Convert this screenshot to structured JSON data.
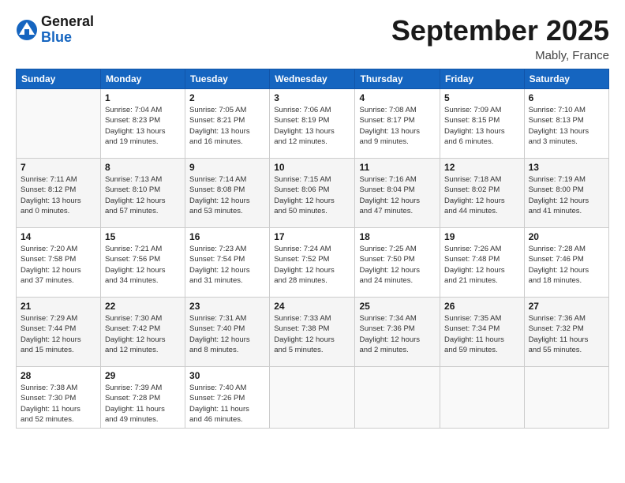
{
  "header": {
    "logo": {
      "general": "General",
      "blue": "Blue"
    },
    "title": "September 2025",
    "location": "Mably, France"
  },
  "weekdays": [
    "Sunday",
    "Monday",
    "Tuesday",
    "Wednesday",
    "Thursday",
    "Friday",
    "Saturday"
  ],
  "weeks": [
    [
      {
        "day": "",
        "info": ""
      },
      {
        "day": "1",
        "info": "Sunrise: 7:04 AM\nSunset: 8:23 PM\nDaylight: 13 hours\nand 19 minutes."
      },
      {
        "day": "2",
        "info": "Sunrise: 7:05 AM\nSunset: 8:21 PM\nDaylight: 13 hours\nand 16 minutes."
      },
      {
        "day": "3",
        "info": "Sunrise: 7:06 AM\nSunset: 8:19 PM\nDaylight: 13 hours\nand 12 minutes."
      },
      {
        "day": "4",
        "info": "Sunrise: 7:08 AM\nSunset: 8:17 PM\nDaylight: 13 hours\nand 9 minutes."
      },
      {
        "day": "5",
        "info": "Sunrise: 7:09 AM\nSunset: 8:15 PM\nDaylight: 13 hours\nand 6 minutes."
      },
      {
        "day": "6",
        "info": "Sunrise: 7:10 AM\nSunset: 8:13 PM\nDaylight: 13 hours\nand 3 minutes."
      }
    ],
    [
      {
        "day": "7",
        "info": "Sunrise: 7:11 AM\nSunset: 8:12 PM\nDaylight: 13 hours\nand 0 minutes."
      },
      {
        "day": "8",
        "info": "Sunrise: 7:13 AM\nSunset: 8:10 PM\nDaylight: 12 hours\nand 57 minutes."
      },
      {
        "day": "9",
        "info": "Sunrise: 7:14 AM\nSunset: 8:08 PM\nDaylight: 12 hours\nand 53 minutes."
      },
      {
        "day": "10",
        "info": "Sunrise: 7:15 AM\nSunset: 8:06 PM\nDaylight: 12 hours\nand 50 minutes."
      },
      {
        "day": "11",
        "info": "Sunrise: 7:16 AM\nSunset: 8:04 PM\nDaylight: 12 hours\nand 47 minutes."
      },
      {
        "day": "12",
        "info": "Sunrise: 7:18 AM\nSunset: 8:02 PM\nDaylight: 12 hours\nand 44 minutes."
      },
      {
        "day": "13",
        "info": "Sunrise: 7:19 AM\nSunset: 8:00 PM\nDaylight: 12 hours\nand 41 minutes."
      }
    ],
    [
      {
        "day": "14",
        "info": "Sunrise: 7:20 AM\nSunset: 7:58 PM\nDaylight: 12 hours\nand 37 minutes."
      },
      {
        "day": "15",
        "info": "Sunrise: 7:21 AM\nSunset: 7:56 PM\nDaylight: 12 hours\nand 34 minutes."
      },
      {
        "day": "16",
        "info": "Sunrise: 7:23 AM\nSunset: 7:54 PM\nDaylight: 12 hours\nand 31 minutes."
      },
      {
        "day": "17",
        "info": "Sunrise: 7:24 AM\nSunset: 7:52 PM\nDaylight: 12 hours\nand 28 minutes."
      },
      {
        "day": "18",
        "info": "Sunrise: 7:25 AM\nSunset: 7:50 PM\nDaylight: 12 hours\nand 24 minutes."
      },
      {
        "day": "19",
        "info": "Sunrise: 7:26 AM\nSunset: 7:48 PM\nDaylight: 12 hours\nand 21 minutes."
      },
      {
        "day": "20",
        "info": "Sunrise: 7:28 AM\nSunset: 7:46 PM\nDaylight: 12 hours\nand 18 minutes."
      }
    ],
    [
      {
        "day": "21",
        "info": "Sunrise: 7:29 AM\nSunset: 7:44 PM\nDaylight: 12 hours\nand 15 minutes."
      },
      {
        "day": "22",
        "info": "Sunrise: 7:30 AM\nSunset: 7:42 PM\nDaylight: 12 hours\nand 12 minutes."
      },
      {
        "day": "23",
        "info": "Sunrise: 7:31 AM\nSunset: 7:40 PM\nDaylight: 12 hours\nand 8 minutes."
      },
      {
        "day": "24",
        "info": "Sunrise: 7:33 AM\nSunset: 7:38 PM\nDaylight: 12 hours\nand 5 minutes."
      },
      {
        "day": "25",
        "info": "Sunrise: 7:34 AM\nSunset: 7:36 PM\nDaylight: 12 hours\nand 2 minutes."
      },
      {
        "day": "26",
        "info": "Sunrise: 7:35 AM\nSunset: 7:34 PM\nDaylight: 11 hours\nand 59 minutes."
      },
      {
        "day": "27",
        "info": "Sunrise: 7:36 AM\nSunset: 7:32 PM\nDaylight: 11 hours\nand 55 minutes."
      }
    ],
    [
      {
        "day": "28",
        "info": "Sunrise: 7:38 AM\nSunset: 7:30 PM\nDaylight: 11 hours\nand 52 minutes."
      },
      {
        "day": "29",
        "info": "Sunrise: 7:39 AM\nSunset: 7:28 PM\nDaylight: 11 hours\nand 49 minutes."
      },
      {
        "day": "30",
        "info": "Sunrise: 7:40 AM\nSunset: 7:26 PM\nDaylight: 11 hours\nand 46 minutes."
      },
      {
        "day": "",
        "info": ""
      },
      {
        "day": "",
        "info": ""
      },
      {
        "day": "",
        "info": ""
      },
      {
        "day": "",
        "info": ""
      }
    ]
  ]
}
